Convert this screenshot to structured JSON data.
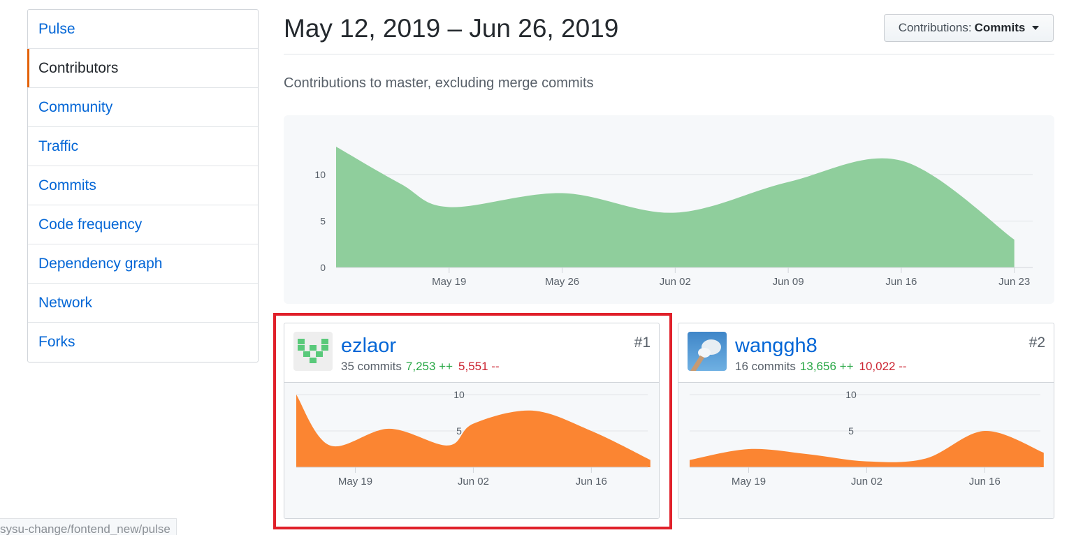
{
  "sidebar": {
    "items": [
      {
        "label": "Pulse",
        "selected": false
      },
      {
        "label": "Contributors",
        "selected": true
      },
      {
        "label": "Community",
        "selected": false
      },
      {
        "label": "Traffic",
        "selected": false
      },
      {
        "label": "Commits",
        "selected": false
      },
      {
        "label": "Code frequency",
        "selected": false
      },
      {
        "label": "Dependency graph",
        "selected": false
      },
      {
        "label": "Network",
        "selected": false
      },
      {
        "label": "Forks",
        "selected": false
      }
    ]
  },
  "header": {
    "date_range": "May 12, 2019 – Jun 26, 2019",
    "contributions_label": "Contributions:",
    "contributions_value": "Commits",
    "subtitle": "Contributions to master, excluding merge commits"
  },
  "chart_data": [
    {
      "type": "area",
      "x": [
        "May 12",
        "May 16",
        "May 19",
        "May 26",
        "Jun 02",
        "Jun 09",
        "Jun 16",
        "Jun 23"
      ],
      "y": [
        13,
        9,
        6.5,
        8,
        5.9,
        9.2,
        11.5,
        3
      ],
      "x_ticks": [
        "May 19",
        "May 26",
        "Jun 02",
        "Jun 09",
        "Jun 16",
        "Jun 23"
      ],
      "y_ticks": [
        0,
        5,
        10
      ],
      "ylim": [
        0,
        13
      ],
      "grid": true,
      "color": "#8fce9c"
    },
    {
      "type": "area",
      "x": [
        "May 12",
        "May 16",
        "May 23",
        "May 30",
        "Jun 02",
        "Jun 09",
        "Jun 16",
        "Jun 23"
      ],
      "y": [
        10,
        3,
        5.3,
        3,
        6,
        7.8,
        5,
        1
      ],
      "x_ticks": [
        "May 19",
        "Jun 02",
        "Jun 16"
      ],
      "y_ticks": [
        5,
        10
      ],
      "ylim": [
        0,
        10
      ],
      "grid": true,
      "color": "#fb8532"
    },
    {
      "type": "area",
      "x": [
        "May 12",
        "May 19",
        "May 26",
        "Jun 02",
        "Jun 09",
        "Jun 16",
        "Jun 23"
      ],
      "y": [
        1,
        2.5,
        1.8,
        0.8,
        1.2,
        5,
        2
      ],
      "x_ticks": [
        "May 19",
        "Jun 02",
        "Jun 16"
      ],
      "y_ticks": [
        5,
        10
      ],
      "ylim": [
        0,
        10
      ],
      "grid": true,
      "color": "#fb8532"
    }
  ],
  "contributors": [
    {
      "name": "ezlaor",
      "commits": "35 commits",
      "additions": "7,253 ++",
      "deletions": "5,551 --",
      "rank": "#1"
    },
    {
      "name": "wanggh8",
      "commits": "16 commits",
      "additions": "13,656 ++",
      "deletions": "10,022 --",
      "rank": "#2"
    }
  ],
  "status_bar": {
    "url": "sysu-change/fontend_new/pulse"
  },
  "colors": {
    "link": "#0366d6",
    "selected_accent": "#e36209",
    "main_area": "#8fce9c",
    "contributor_area": "#fb8532",
    "highlight": "#e0202a"
  }
}
